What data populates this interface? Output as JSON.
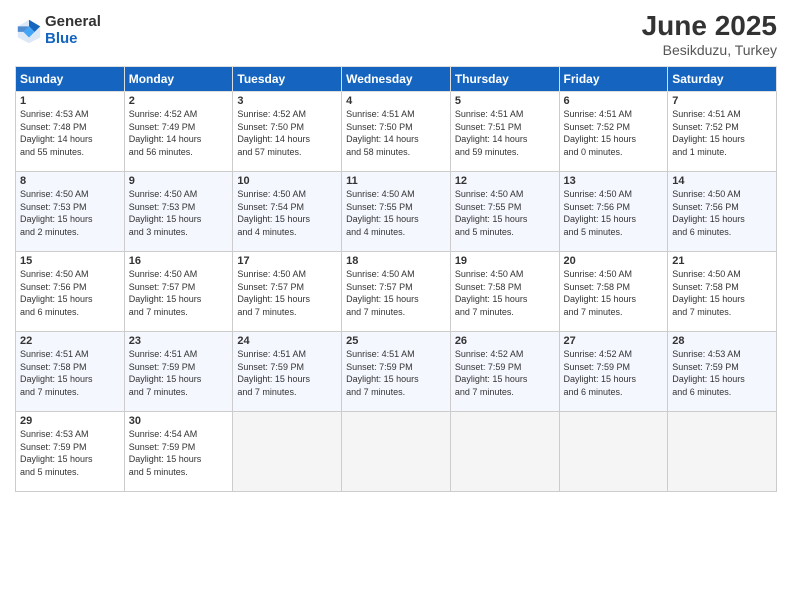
{
  "header": {
    "logo_general": "General",
    "logo_blue": "Blue",
    "month_title": "June 2025",
    "location": "Besikduzu, Turkey"
  },
  "days_of_week": [
    "Sunday",
    "Monday",
    "Tuesday",
    "Wednesday",
    "Thursday",
    "Friday",
    "Saturday"
  ],
  "weeks": [
    [
      {
        "day": 1,
        "lines": [
          "Sunrise: 4:53 AM",
          "Sunset: 7:48 PM",
          "Daylight: 14 hours",
          "and 55 minutes."
        ]
      },
      {
        "day": 2,
        "lines": [
          "Sunrise: 4:52 AM",
          "Sunset: 7:49 PM",
          "Daylight: 14 hours",
          "and 56 minutes."
        ]
      },
      {
        "day": 3,
        "lines": [
          "Sunrise: 4:52 AM",
          "Sunset: 7:50 PM",
          "Daylight: 14 hours",
          "and 57 minutes."
        ]
      },
      {
        "day": 4,
        "lines": [
          "Sunrise: 4:51 AM",
          "Sunset: 7:50 PM",
          "Daylight: 14 hours",
          "and 58 minutes."
        ]
      },
      {
        "day": 5,
        "lines": [
          "Sunrise: 4:51 AM",
          "Sunset: 7:51 PM",
          "Daylight: 14 hours",
          "and 59 minutes."
        ]
      },
      {
        "day": 6,
        "lines": [
          "Sunrise: 4:51 AM",
          "Sunset: 7:52 PM",
          "Daylight: 15 hours",
          "and 0 minutes."
        ]
      },
      {
        "day": 7,
        "lines": [
          "Sunrise: 4:51 AM",
          "Sunset: 7:52 PM",
          "Daylight: 15 hours",
          "and 1 minute."
        ]
      }
    ],
    [
      {
        "day": 8,
        "lines": [
          "Sunrise: 4:50 AM",
          "Sunset: 7:53 PM",
          "Daylight: 15 hours",
          "and 2 minutes."
        ]
      },
      {
        "day": 9,
        "lines": [
          "Sunrise: 4:50 AM",
          "Sunset: 7:53 PM",
          "Daylight: 15 hours",
          "and 3 minutes."
        ]
      },
      {
        "day": 10,
        "lines": [
          "Sunrise: 4:50 AM",
          "Sunset: 7:54 PM",
          "Daylight: 15 hours",
          "and 4 minutes."
        ]
      },
      {
        "day": 11,
        "lines": [
          "Sunrise: 4:50 AM",
          "Sunset: 7:55 PM",
          "Daylight: 15 hours",
          "and 4 minutes."
        ]
      },
      {
        "day": 12,
        "lines": [
          "Sunrise: 4:50 AM",
          "Sunset: 7:55 PM",
          "Daylight: 15 hours",
          "and 5 minutes."
        ]
      },
      {
        "day": 13,
        "lines": [
          "Sunrise: 4:50 AM",
          "Sunset: 7:56 PM",
          "Daylight: 15 hours",
          "and 5 minutes."
        ]
      },
      {
        "day": 14,
        "lines": [
          "Sunrise: 4:50 AM",
          "Sunset: 7:56 PM",
          "Daylight: 15 hours",
          "and 6 minutes."
        ]
      }
    ],
    [
      {
        "day": 15,
        "lines": [
          "Sunrise: 4:50 AM",
          "Sunset: 7:56 PM",
          "Daylight: 15 hours",
          "and 6 minutes."
        ]
      },
      {
        "day": 16,
        "lines": [
          "Sunrise: 4:50 AM",
          "Sunset: 7:57 PM",
          "Daylight: 15 hours",
          "and 7 minutes."
        ]
      },
      {
        "day": 17,
        "lines": [
          "Sunrise: 4:50 AM",
          "Sunset: 7:57 PM",
          "Daylight: 15 hours",
          "and 7 minutes."
        ]
      },
      {
        "day": 18,
        "lines": [
          "Sunrise: 4:50 AM",
          "Sunset: 7:57 PM",
          "Daylight: 15 hours",
          "and 7 minutes."
        ]
      },
      {
        "day": 19,
        "lines": [
          "Sunrise: 4:50 AM",
          "Sunset: 7:58 PM",
          "Daylight: 15 hours",
          "and 7 minutes."
        ]
      },
      {
        "day": 20,
        "lines": [
          "Sunrise: 4:50 AM",
          "Sunset: 7:58 PM",
          "Daylight: 15 hours",
          "and 7 minutes."
        ]
      },
      {
        "day": 21,
        "lines": [
          "Sunrise: 4:50 AM",
          "Sunset: 7:58 PM",
          "Daylight: 15 hours",
          "and 7 minutes."
        ]
      }
    ],
    [
      {
        "day": 22,
        "lines": [
          "Sunrise: 4:51 AM",
          "Sunset: 7:58 PM",
          "Daylight: 15 hours",
          "and 7 minutes."
        ]
      },
      {
        "day": 23,
        "lines": [
          "Sunrise: 4:51 AM",
          "Sunset: 7:59 PM",
          "Daylight: 15 hours",
          "and 7 minutes."
        ]
      },
      {
        "day": 24,
        "lines": [
          "Sunrise: 4:51 AM",
          "Sunset: 7:59 PM",
          "Daylight: 15 hours",
          "and 7 minutes."
        ]
      },
      {
        "day": 25,
        "lines": [
          "Sunrise: 4:51 AM",
          "Sunset: 7:59 PM",
          "Daylight: 15 hours",
          "and 7 minutes."
        ]
      },
      {
        "day": 26,
        "lines": [
          "Sunrise: 4:52 AM",
          "Sunset: 7:59 PM",
          "Daylight: 15 hours",
          "and 7 minutes."
        ]
      },
      {
        "day": 27,
        "lines": [
          "Sunrise: 4:52 AM",
          "Sunset: 7:59 PM",
          "Daylight: 15 hours",
          "and 6 minutes."
        ]
      },
      {
        "day": 28,
        "lines": [
          "Sunrise: 4:53 AM",
          "Sunset: 7:59 PM",
          "Daylight: 15 hours",
          "and 6 minutes."
        ]
      }
    ],
    [
      {
        "day": 29,
        "lines": [
          "Sunrise: 4:53 AM",
          "Sunset: 7:59 PM",
          "Daylight: 15 hours",
          "and 5 minutes."
        ]
      },
      {
        "day": 30,
        "lines": [
          "Sunrise: 4:54 AM",
          "Sunset: 7:59 PM",
          "Daylight: 15 hours",
          "and 5 minutes."
        ]
      },
      null,
      null,
      null,
      null,
      null
    ]
  ]
}
